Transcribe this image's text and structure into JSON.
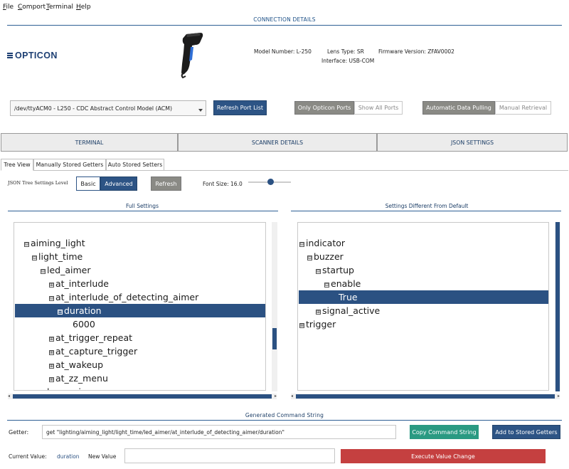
{
  "menu": [
    {
      "first": "F",
      "rest": "ile"
    },
    {
      "first": "C",
      "rest": "omport"
    },
    {
      "first": "T",
      "rest": "erminal"
    },
    {
      "first": "H",
      "rest": "elp"
    }
  ],
  "connection": {
    "title": "CONNECTION DETAILS",
    "brand": "OPTICON",
    "model_number": "Model Number: L-250",
    "lens_type": "Lens Type: SR",
    "firmware_version": "Firmware Version: ZFAV0002",
    "interface": "Interface: USB-COM",
    "port_selected": "/dev/ttyACM0 - L250 - CDC Abstract Control Model (ACM)",
    "refresh_port_list": "Refresh Port List",
    "only_opticon_ports": "Only Opticon Ports",
    "show_all_ports": "Show All Ports",
    "automatic_data_pulling": "Automatic Data Pulling",
    "manual_retrieval": "Manual Retrieval"
  },
  "main_tabs": [
    "TERMINAL",
    "SCANNER DETAILS",
    "JSON SETTINGS"
  ],
  "sub_tabs": [
    "Tree View",
    "Manually Stored Getters",
    "Auto Stored Setters"
  ],
  "settings_level": {
    "label": "JSON Tree Settings Level",
    "basic": "Basic",
    "advanced": "Advanced",
    "refresh": "Refresh",
    "font_size": "Font Size: 16.0",
    "font_size_value": 16.0
  },
  "full_settings": {
    "title": "Full Settings",
    "rows": [
      {
        "label": "aiming_light",
        "marker": "⊟"
      },
      {
        "label": "light_time",
        "marker": "⊟"
      },
      {
        "label": "led_aimer",
        "marker": "⊟"
      },
      {
        "label": "at_interlude",
        "marker": "⊞"
      },
      {
        "label": "at_interlude_of_detecting_aimer",
        "marker": "⊟"
      },
      {
        "label": "duration",
        "marker": "⊟"
      },
      {
        "label": "6000",
        "marker": ""
      },
      {
        "label": "at_trigger_repeat",
        "marker": "⊞"
      },
      {
        "label": "at_capture_trigger",
        "marker": "⊞"
      },
      {
        "label": "at_wakeup",
        "marker": "⊞"
      },
      {
        "label": "at_zz_menu",
        "marker": "⊞"
      },
      {
        "label": "laser_aimer",
        "marker": "⊞"
      }
    ]
  },
  "diff_settings": {
    "title": "Settings Different From Default",
    "rows": [
      {
        "label": "indicator",
        "marker": "⊟"
      },
      {
        "label": "buzzer",
        "marker": "⊟"
      },
      {
        "label": "startup",
        "marker": "⊟"
      },
      {
        "label": "enable",
        "marker": "⊟"
      },
      {
        "label": "True",
        "marker": ""
      },
      {
        "label": "signal_active",
        "marker": "⊞"
      },
      {
        "label": "trigger",
        "marker": "⊞"
      }
    ]
  },
  "command": {
    "title": "Generated Command String",
    "getter_label": "Getter:",
    "getter_value": "get \"lighting/aiming_light/light_time/led_aimer/at_interlude_of_detecting_aimer/duration\"",
    "copy_button": "Copy Command String",
    "add_button": "Add to Stored Getters",
    "current_value_label": "Current Value:",
    "current_value": "duration",
    "new_value_label": "New Value",
    "new_value": "",
    "execute_button": "Execute Value Change"
  },
  "colors": {
    "accent": "#2b5182",
    "brand": "#1d3f73",
    "teal": "#2a9a82",
    "danger": "#c54040"
  }
}
